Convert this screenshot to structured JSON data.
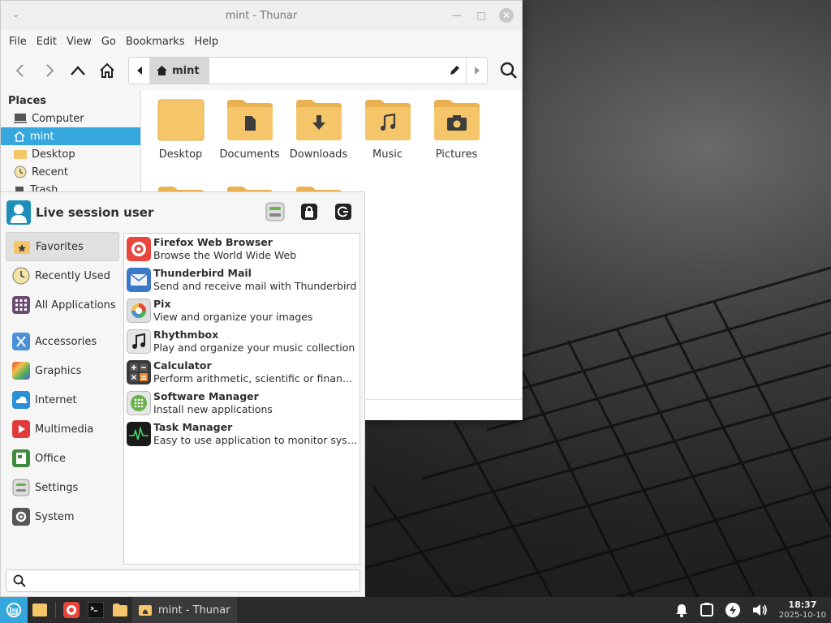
{
  "thunar": {
    "title": "mint - Thunar",
    "menu": [
      "File",
      "Edit",
      "View",
      "Go",
      "Bookmarks",
      "Help"
    ],
    "path_crumb": "mint",
    "sidebar": {
      "heading": "Places",
      "items": [
        {
          "label": "Computer",
          "icon": "computer-icon"
        },
        {
          "label": "mint",
          "icon": "home-icon",
          "active": true
        },
        {
          "label": "Desktop",
          "icon": "desktop-folder-icon"
        },
        {
          "label": "Recent",
          "icon": "recent-icon"
        },
        {
          "label": "Trash",
          "icon": "trash-icon"
        }
      ]
    },
    "files": [
      {
        "label": "Desktop",
        "icon": "desktop-folder-icon"
      },
      {
        "label": "Documents",
        "icon": "documents-folder-icon"
      },
      {
        "label": "Downloads",
        "icon": "downloads-folder-icon"
      },
      {
        "label": "Music",
        "icon": "music-folder-icon"
      },
      {
        "label": "Pictures",
        "icon": "pictures-folder-icon"
      }
    ]
  },
  "menu": {
    "user": "Live session user",
    "categories": [
      {
        "label": "Favorites",
        "icon": "favorites-icon",
        "active": true
      },
      {
        "label": "Recently Used",
        "icon": "recent-icon"
      },
      {
        "label": "All Applications",
        "icon": "all-apps-icon"
      },
      {
        "label": "Accessories",
        "icon": "accessories-icon"
      },
      {
        "label": "Graphics",
        "icon": "graphics-icon"
      },
      {
        "label": "Internet",
        "icon": "internet-icon"
      },
      {
        "label": "Multimedia",
        "icon": "multimedia-icon"
      },
      {
        "label": "Office",
        "icon": "office-icon"
      },
      {
        "label": "Settings",
        "icon": "settings-icon"
      },
      {
        "label": "System",
        "icon": "system-icon"
      }
    ],
    "apps": [
      {
        "name": "Firefox Web Browser",
        "desc": "Browse the World Wide Web",
        "icon": "firefox-icon"
      },
      {
        "name": "Thunderbird Mail",
        "desc": "Send and receive mail with Thunderbird",
        "icon": "thunderbird-icon"
      },
      {
        "name": "Pix",
        "desc": "View and organize your images",
        "icon": "pix-icon"
      },
      {
        "name": "Rhythmbox",
        "desc": "Play and organize your music collection",
        "icon": "rhythmbox-icon"
      },
      {
        "name": "Calculator",
        "desc": "Perform arithmetic, scientific or financi…",
        "icon": "calculator-icon"
      },
      {
        "name": "Software Manager",
        "desc": "Install new applications",
        "icon": "software-manager-icon"
      },
      {
        "name": "Task Manager",
        "desc": "Easy to use application to monitor syste…",
        "icon": "task-manager-icon"
      }
    ],
    "search_value": ""
  },
  "taskbar": {
    "window_label": "mint - Thunar",
    "time": "18:37",
    "date": "2025-10-10"
  },
  "colors": {
    "accent": "#35a7dc",
    "folder": "#f5c56a",
    "taskbar": "#2b2b2b"
  }
}
